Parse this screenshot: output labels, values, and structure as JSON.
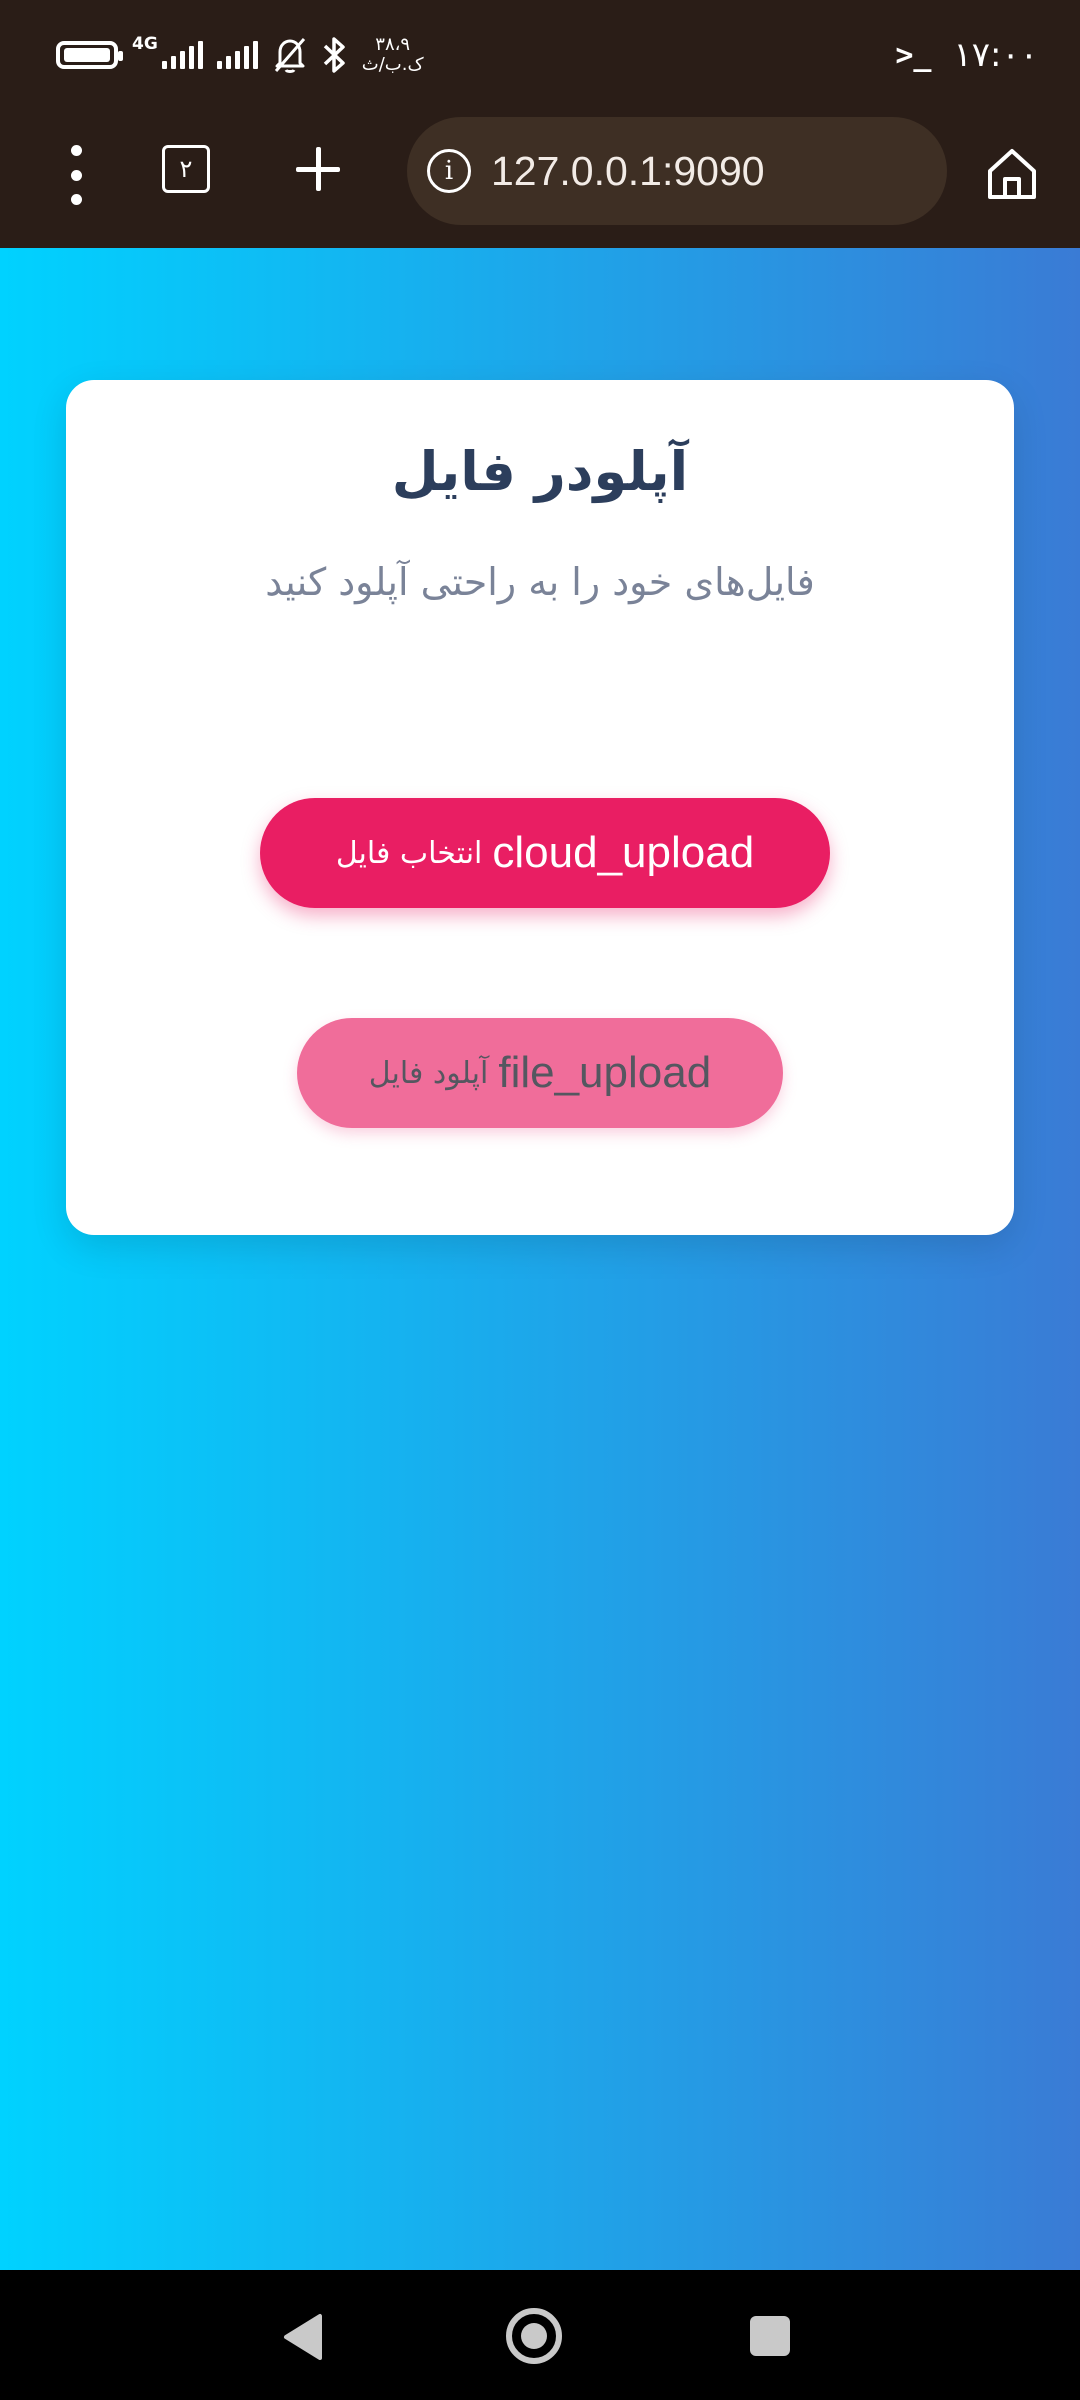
{
  "status_bar": {
    "network_type": "4G",
    "speed_value": "۳۸،۹",
    "speed_unit": "ک.ب/ث",
    "time": "۱۷:۰۰",
    "terminal_glyph": ">_"
  },
  "browser": {
    "tabs_count": "۲",
    "url": "127.0.0.1:9090",
    "info_glyph": "i"
  },
  "card": {
    "title": "آپلودر فایل",
    "subtitle": "فایل‌های خود را به راحتی آپلود کنید",
    "select_button": {
      "icon_text": "cloud_upload",
      "label": "انتخاب فایل"
    },
    "upload_button": {
      "icon_text": "file_upload",
      "label": "آپلود فایل"
    }
  },
  "icons": {
    "battery": "battery-icon",
    "signal": "signal-icon",
    "mute": "bell-off-icon",
    "bluetooth": "bluetooth-icon",
    "menu": "menu-dots-icon",
    "tabs": "tabs-icon",
    "new_tab": "plus-icon",
    "info": "info-icon",
    "home": "home-icon",
    "nav_back": "back-icon",
    "nav_home": "home-circle-icon",
    "nav_recents": "recents-icon"
  },
  "colors": {
    "gradient_start": "#00d2ff",
    "gradient_end": "#3a7bd5",
    "primary_button": "#e91e63",
    "secondary_button": "#f06d9a",
    "title": "#2c3e5c",
    "browser_chrome": "#2a1d17"
  }
}
